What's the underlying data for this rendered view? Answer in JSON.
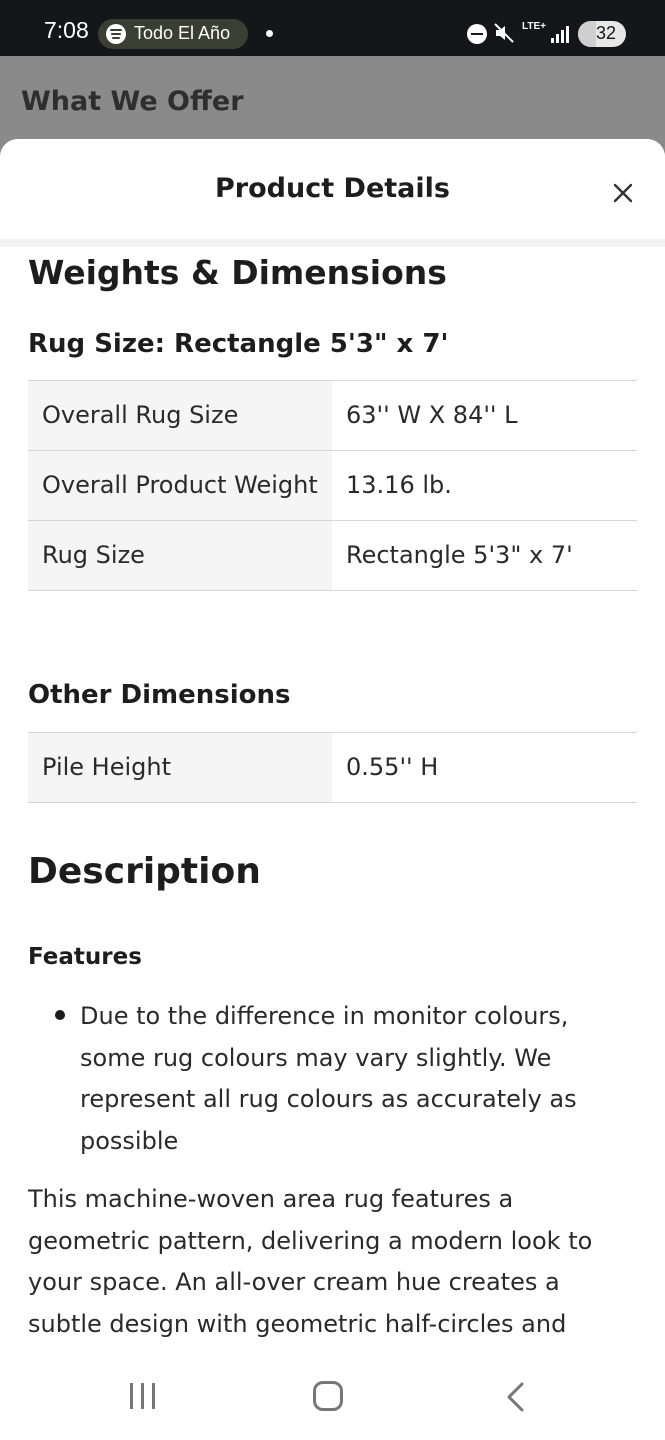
{
  "status_bar": {
    "time": "7:08",
    "now_playing": "Todo El Año",
    "network": "LTE+",
    "battery": "32"
  },
  "background_page": {
    "title": "What We Offer"
  },
  "sheet": {
    "title": "Product Details",
    "weights_dimensions": {
      "heading": "Weights & Dimensions",
      "rug_size_heading": "Rug Size: Rectangle 5'3\" x 7'",
      "rows": [
        {
          "label": "Overall Rug Size",
          "value": "63'' W X 84'' L"
        },
        {
          "label": "Overall Product Weight",
          "value": "13.16 lb."
        },
        {
          "label": "Rug Size",
          "value": "Rectangle 5'3\" x 7'"
        }
      ],
      "other_heading": "Other Dimensions",
      "other_rows": [
        {
          "label": "Pile Height",
          "value": "0.55'' H"
        }
      ]
    },
    "description": {
      "heading": "Description",
      "features_heading": "Features",
      "features": [
        "Due to the difference in monitor colours, some rug colours may vary slightly. We represent all rug colours as accurately as possible"
      ],
      "paragraph": "This machine-woven area rug features a geometric pattern, delivering a modern look to your space. An all-over cream hue creates a subtle design with geometric half-circles and"
    }
  },
  "colors": {
    "status_bar_bg": "#14161a",
    "scrim": "#8a8a8a",
    "table_key_bg": "#f5f5f5",
    "text": "#1d1d1d"
  }
}
